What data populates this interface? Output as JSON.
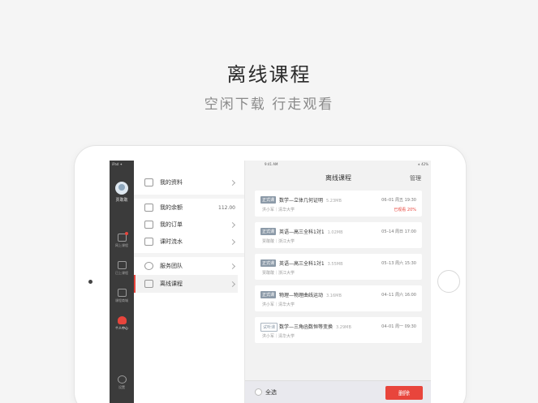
{
  "hero": {
    "title": "离线课程",
    "subtitle": "空闲下载  行走观看"
  },
  "rail": {
    "status": "iPad ✦",
    "user_name": "贾敢敢",
    "items": [
      {
        "label": "网上课程",
        "icon": "monitor-icon"
      },
      {
        "label": "已上课程",
        "icon": "calendar-icon"
      },
      {
        "label": "课程商城",
        "icon": "shop-bag-icon"
      },
      {
        "label": "个人中心",
        "icon": "person-icon"
      },
      {
        "label": "设置",
        "icon": "gear-icon"
      }
    ]
  },
  "menu": {
    "items": [
      {
        "label": "我的资料",
        "icon": "profile-card-icon"
      },
      {
        "label": "我的余额",
        "value": "112.00",
        "icon": "wallet-icon"
      },
      {
        "label": "我的订单",
        "icon": "order-icon"
      },
      {
        "label": "课时流水",
        "icon": "calendar-list-icon"
      },
      {
        "label": "服务团队",
        "icon": "headset-icon"
      },
      {
        "label": "离线课程",
        "icon": "download-icon"
      }
    ]
  },
  "panel": {
    "status_time": "9:41 AM",
    "battery": "∗ 42%",
    "title": "离线课程",
    "manage": "管理",
    "courses": [
      {
        "tag": "正式课",
        "title": "数学—立体几何证明",
        "size": "5.23MB",
        "time": "06–01 周五 19:30",
        "teacher": "洪小军｜清华大学",
        "status": "已观看 20%"
      },
      {
        "tag": "正式课",
        "title": "英语—高三全科1対1",
        "size": "1.02MB",
        "time": "05–14 周日 17:00",
        "teacher": "贾敢敢｜浙江大学",
        "status": ""
      },
      {
        "tag": "正式课",
        "title": "英语—高三全科1対1",
        "size": "3.55MB",
        "time": "05–13 周六 15:30",
        "teacher": "贾敢敢｜浙江大学",
        "status": ""
      },
      {
        "tag": "正式课",
        "title": "物理—物理曲线运动",
        "size": "3.16MB",
        "time": "04–11 周六 16:00",
        "teacher": "洪小军｜清华大学",
        "status": ""
      },
      {
        "tag": "试听课",
        "title": "数学—三角函数恒等变换",
        "size": "3.29MB",
        "time": "04–01 周一 09:30",
        "teacher": "洪小军｜清华大学",
        "status": ""
      }
    ],
    "select_all": "全选",
    "delete": "删除"
  },
  "colors": {
    "accent": "#e8453c",
    "rail_bg": "#3b3b3b",
    "tag_bg": "#8c9aa8"
  }
}
